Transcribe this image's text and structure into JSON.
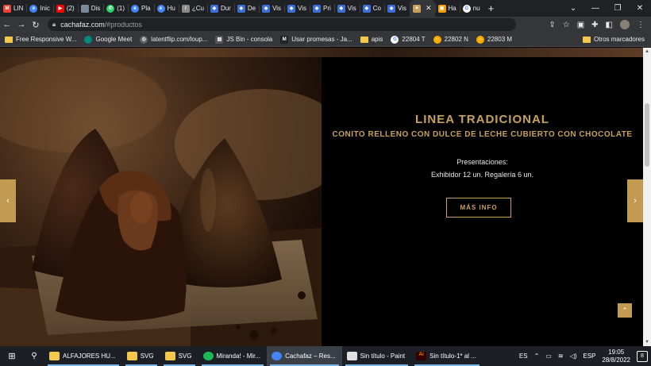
{
  "tabs": [
    {
      "label": "LIN",
      "icon": "gmail-icon",
      "color": "#ea4335"
    },
    {
      "label": "Inic",
      "icon": "chrome-icon",
      "color": "#4285f4"
    },
    {
      "label": "(2)",
      "icon": "youtube-icon",
      "color": "#ff0000"
    },
    {
      "label": "Dis",
      "icon": "page-icon",
      "color": "#7a8a9a"
    },
    {
      "label": "(1)",
      "icon": "whatsapp-icon",
      "color": "#25d366"
    },
    {
      "label": "Pla",
      "icon": "chrome-icon",
      "color": "#4285f4"
    },
    {
      "label": "Hu",
      "icon": "chrome-icon",
      "color": "#4285f4"
    },
    {
      "label": "¿Cu",
      "icon": "pencil-icon",
      "color": "#8a8a8a"
    },
    {
      "label": "Dur",
      "icon": "shield-icon",
      "color": "#3b6fd6"
    },
    {
      "label": "De",
      "icon": "shield-icon",
      "color": "#3b6fd6"
    },
    {
      "label": "Vis",
      "icon": "shield-icon",
      "color": "#3b6fd6"
    },
    {
      "label": "Vis",
      "icon": "shield-icon",
      "color": "#3b6fd6"
    },
    {
      "label": "Pri",
      "icon": "shield-icon",
      "color": "#3b6fd6"
    },
    {
      "label": "Vis",
      "icon": "shield-icon",
      "color": "#3b6fd6"
    },
    {
      "label": "Co",
      "icon": "shield-icon",
      "color": "#3b6fd6"
    },
    {
      "label": "Vis",
      "icon": "shield-icon",
      "color": "#3b6fd6"
    }
  ],
  "active_tab": {
    "icon": "cachafaz-icon",
    "color": "#c8a15a"
  },
  "tabs_after": [
    {
      "label": "Ha",
      "icon": "bookmark-icon",
      "color": "#f59e0b"
    },
    {
      "label": "nu",
      "icon": "google-icon",
      "color": "#ffffff"
    }
  ],
  "address": {
    "host": "cachafaz.com",
    "path": "/#productos"
  },
  "bookmarks": [
    {
      "label": "Free Responsive W...",
      "icon": "folder-icon"
    },
    {
      "label": "Google Meet",
      "icon": "meet-icon"
    },
    {
      "label": "latentflip.com/loup...",
      "icon": "globe-icon"
    },
    {
      "label": "JS Bin - consola",
      "icon": "jsbin-icon"
    },
    {
      "label": "Usar promesas - Ja...",
      "icon": "mdn-icon"
    },
    {
      "label": "apis",
      "icon": "folder-icon"
    },
    {
      "label": "22804 T",
      "icon": "google-icon"
    },
    {
      "label": "22802 N",
      "icon": "colab-icon"
    },
    {
      "label": "22803 M",
      "icon": "colab-icon"
    }
  ],
  "other_bookmarks": "Otros marcadores",
  "product": {
    "title": "LINEA TRADICIONAL",
    "subtitle": "CONITO RELLENO CON DULCE DE LECHE CUBIERTO CON CHOCOLATE",
    "presentations_label": "Presentaciones:",
    "presentations_detail": "Exhibidor 12 un. Regalería 6 un.",
    "button_label": "MÁS INFO"
  },
  "accent_color": "#c8a15a",
  "taskbar": {
    "apps": [
      {
        "label": "ALFAJORES HU...",
        "icon": "folder-icon"
      },
      {
        "label": "SVG",
        "icon": "folder-icon"
      },
      {
        "label": "SVG",
        "icon": "folder-icon"
      },
      {
        "label": "Miranda! - Mir...",
        "icon": "spotify-icon"
      },
      {
        "label": "Cachafaz – Res...",
        "icon": "chrome-icon"
      },
      {
        "label": "Sin título - Paint",
        "icon": "paint-icon"
      },
      {
        "label": "Sin título-1* al ...",
        "icon": "illustrator-icon"
      }
    ],
    "lang": "ES",
    "keyboard": "ESP",
    "time": "19:05",
    "date": "28/8/2022",
    "notifications": "8"
  }
}
